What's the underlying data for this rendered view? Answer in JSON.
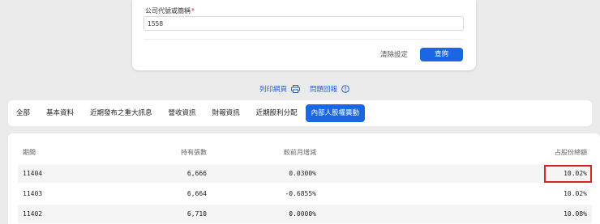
{
  "form": {
    "label": "公司代號或簡稱",
    "required_mark": "*",
    "input_value": "1558",
    "clear_label": "清除設定",
    "query_label": "查詢"
  },
  "links": {
    "print": "列印網頁",
    "print_icon": "printer-icon",
    "report": "問題回報",
    "report_icon": "info-circle-icon"
  },
  "tabs": [
    {
      "label": "全部"
    },
    {
      "label": "基本資料"
    },
    {
      "label": "近期發布之重大訊息"
    },
    {
      "label": "營收資訊"
    },
    {
      "label": "財報資訊"
    },
    {
      "label": "近期股利分配"
    },
    {
      "label": "內部人股權異動",
      "active": true
    }
  ],
  "table": {
    "headers": [
      "期間",
      "持有張數",
      "較前月增減",
      "占股份總額"
    ],
    "rows": [
      [
        "11404",
        "6,666",
        "0.0300%",
        "10.02%"
      ],
      [
        "11403",
        "6,664",
        "-0.6855%",
        "10.02%"
      ],
      [
        "11402",
        "6,710",
        "0.0000%",
        "10.08%"
      ]
    ]
  },
  "colors": {
    "accent": "#1a66e3",
    "highlight_box": "#d6262b",
    "background": "#ebebeb"
  }
}
